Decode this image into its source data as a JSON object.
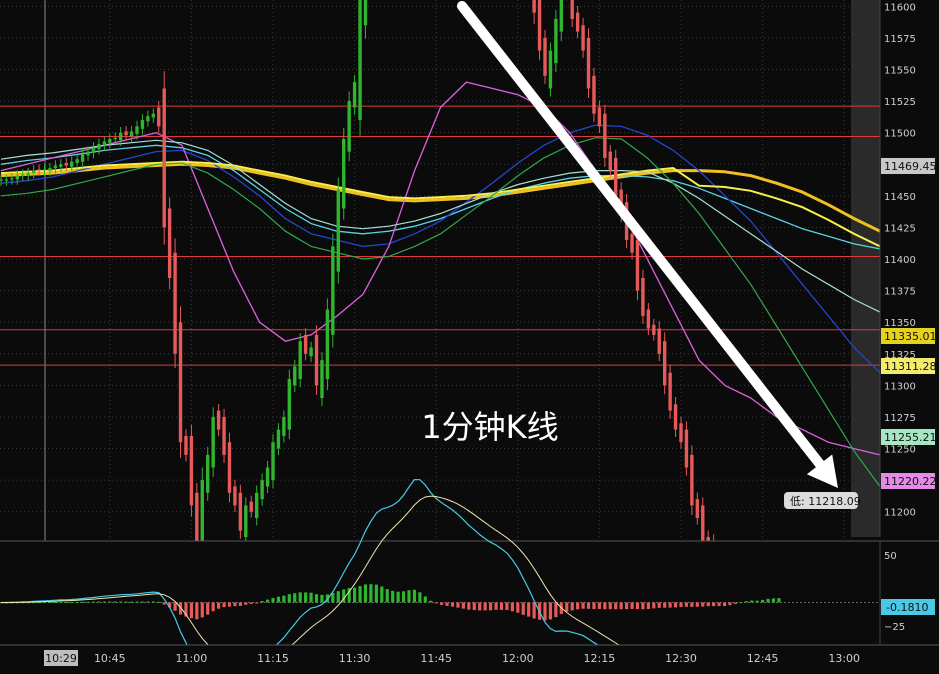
{
  "annotation": "1分钟K线",
  "low_callout": "低: 11218.09",
  "current_time_label": "10:29",
  "price_labels": {
    "last": "11469.45",
    "p1": "11335.01",
    "p2": "11311.28",
    "p3": "11255.21",
    "p4": "11220.22",
    "macd": "-0.1810"
  },
  "colors": {
    "bg": "#0b0b0b",
    "grid": "#3a3a3a",
    "up": "#2fb52f",
    "down": "#e65a5a",
    "level": "#e03a3a",
    "ma_yellow": "#f0c020",
    "ma_yellow2": "#f7f04a",
    "ma_cyan": "#59d3e6",
    "ma_teal": "#a7e0d2",
    "ma_green": "#2fa84f",
    "ma_blue": "#2446d0",
    "ma_magenta": "#e060e0",
    "arrow": "#ffffff"
  },
  "chart_data": [
    {
      "type": "candlestick",
      "x_ticks": [
        "10:45",
        "11:00",
        "11:15",
        "11:30",
        "11:45",
        "12:00",
        "12:15",
        "12:30",
        "12:45",
        "13:00"
      ],
      "x_tick_index": [
        20,
        35,
        50,
        65,
        80,
        95,
        110,
        125,
        140,
        155
      ],
      "y_ticks": [
        11200,
        11225,
        11250,
        11275,
        11300,
        11325,
        11350,
        11375,
        11400,
        11425,
        11450,
        11475,
        11500,
        11525,
        11550,
        11575,
        11600
      ],
      "ylim": [
        11180,
        11605
      ],
      "horizontal_levels": [
        11521,
        11497,
        11402,
        11344,
        11316
      ],
      "start_close": 11462,
      "returns": [
        1,
        0,
        1,
        2,
        1,
        1,
        2,
        0,
        1,
        1,
        2,
        1,
        -1,
        3,
        2,
        4,
        2,
        3,
        3,
        2,
        2,
        1,
        4,
        -2,
        3,
        4,
        5,
        3,
        2,
        -10,
        -80,
        -40,
        -60,
        -70,
        -10,
        -40,
        -30,
        50,
        20,
        30,
        -10,
        -20,
        -30,
        -10,
        -20,
        20,
        -5,
        15,
        10,
        10,
        20,
        10,
        10,
        30,
        10,
        20,
        -10,
        5,
        -30,
        20,
        40,
        50,
        45,
        40,
        30,
        15,
        70,
        55,
        10,
        20,
        -15,
        -10,
        30,
        40,
        60,
        60,
        30,
        -60,
        -50,
        -30,
        20,
        20,
        10,
        5,
        -10,
        -5,
        -10,
        10,
        -5,
        5,
        5,
        10,
        -15,
        -5,
        -40,
        -30,
        -50,
        -30,
        -40,
        -30,
        -20,
        20,
        25,
        30,
        -10,
        -20,
        -10,
        -15,
        -30,
        -20,
        -10,
        -25,
        -10,
        -20,
        -15,
        -20,
        -10,
        -30,
        -20,
        -10,
        -5,
        -15,
        -25,
        -20,
        -15,
        -10,
        -20,
        -30,
        -10,
        -20,
        -10,
        -25,
        -20,
        -20,
        10,
        5,
        15,
        -20,
        -10,
        -30,
        20,
        10,
        -15,
        -5
      ],
      "open_offset": [
        0,
        -1,
        0,
        -1,
        0,
        -1,
        0,
        1,
        0,
        -1,
        0,
        -1,
        1,
        -1,
        -1,
        -2,
        -1,
        -1,
        -1,
        -1,
        -1,
        0,
        -2,
        1,
        -1,
        -2,
        -2,
        -1,
        -1,
        5,
        30,
        15,
        20,
        25,
        5,
        15,
        10,
        -20,
        -10,
        -10,
        5,
        10,
        10,
        5,
        10,
        -5,
        3,
        -5,
        -5,
        -5,
        -10,
        -5,
        -5,
        -10,
        -5,
        -10,
        5,
        -2,
        10,
        -10,
        -15,
        -20,
        -20,
        -15,
        -10,
        -5,
        -30,
        -25,
        -5,
        -10,
        5,
        5,
        -10,
        -15,
        -25,
        -25,
        -10,
        25,
        20,
        10,
        -10,
        -10,
        -5,
        -3,
        5,
        3,
        5,
        -5,
        3,
        -3,
        -3,
        -5,
        5,
        3,
        15,
        10,
        20,
        10,
        15,
        10,
        10,
        -10,
        -10,
        -10,
        5,
        10,
        5,
        5,
        10,
        10,
        5,
        10,
        5,
        10,
        5,
        10,
        5,
        10,
        10,
        5,
        3,
        5,
        10,
        10,
        5,
        5,
        10,
        10,
        5,
        10,
        5,
        10,
        10,
        10,
        -5,
        -3,
        -5,
        10,
        5,
        10,
        -10,
        -5,
        5,
        3
      ],
      "macd_ylim": [
        -45,
        65
      ],
      "macd_ticks": [
        50,
        -25
      ],
      "series": [
        {
          "name": "MA-yellow-slow",
          "values": [
            11466,
            11467,
            11468,
            11470,
            11472,
            11473,
            11474,
            11475,
            11474,
            11472,
            11468,
            11464,
            11459,
            11455,
            11451,
            11447,
            11446,
            11447,
            11448,
            11450,
            11453,
            11456,
            11459,
            11462,
            11465,
            11468,
            11470,
            11470,
            11469,
            11466,
            11460,
            11453,
            11443,
            11432,
            11422
          ]
        },
        {
          "name": "MA-cyan",
          "values": [
            11475,
            11478,
            11480,
            11483,
            11486,
            11488,
            11490,
            11488,
            11482,
            11470,
            11455,
            11440,
            11428,
            11422,
            11420,
            11422,
            11426,
            11432,
            11440,
            11448,
            11455,
            11460,
            11464,
            11466,
            11466,
            11465,
            11462,
            11456,
            11448,
            11440,
            11432,
            11424,
            11418,
            11412,
            11408
          ]
        },
        {
          "name": "MA-blue",
          "values": [
            11460,
            11462,
            11465,
            11470,
            11475,
            11480,
            11485,
            11486,
            11478,
            11465,
            11450,
            11432,
            11420,
            11415,
            11410,
            11412,
            11420,
            11430,
            11445,
            11460,
            11476,
            11490,
            11500,
            11506,
            11505,
            11498,
            11486,
            11470,
            11450,
            11430,
            11405,
            11380,
            11355,
            11330,
            11310
          ]
        },
        {
          "name": "MA-magenta",
          "values": [
            11470,
            11475,
            11480,
            11485,
            11490,
            11495,
            11500,
            11490,
            11440,
            11390,
            11350,
            11335,
            11340,
            11355,
            11372,
            11410,
            11470,
            11520,
            11540,
            11535,
            11530,
            11520,
            11500,
            11470,
            11440,
            11400,
            11360,
            11320,
            11300,
            11290,
            11275,
            11265,
            11255,
            11250,
            11245
          ]
        }
      ]
    }
  ]
}
